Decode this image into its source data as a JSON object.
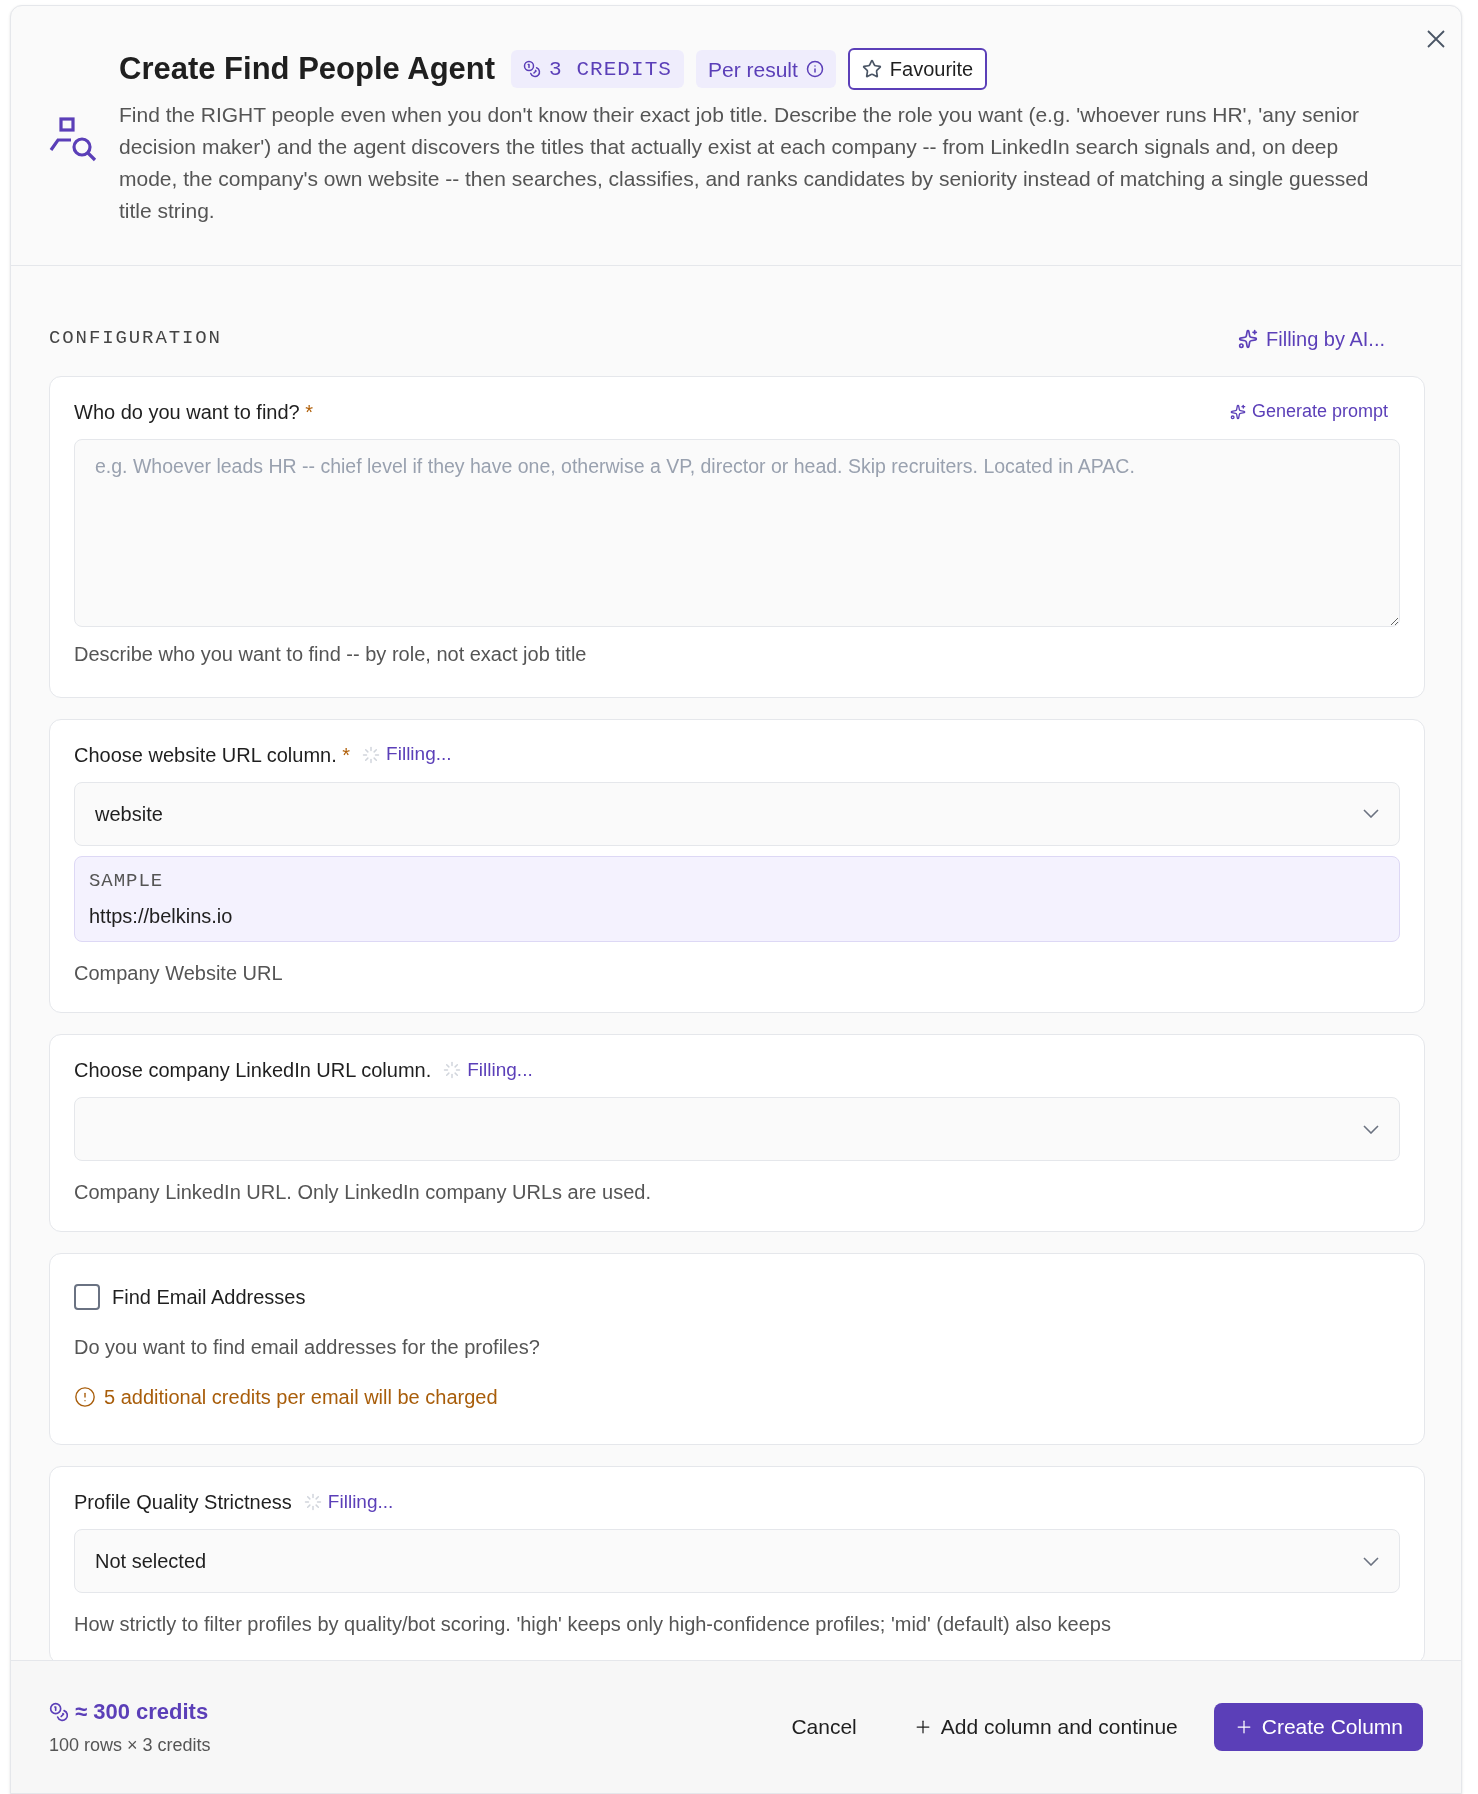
{
  "dialog": {
    "title": "Create Find People Agent",
    "credits_badge": "3 CREDITS",
    "per_result": "Per result",
    "favourite": {
      "label": "Favourite",
      "selected": false
    },
    "description": "Find the RIGHT people even when you don't know their exact job title. Describe the role you want (e.g. 'whoever runs HR', 'any senior decision maker') and the agent discovers the titles that actually exist at each company -- from LinkedIn search signals and, on deep mode, the company's own website -- then searches, classifies, and ranks candidates by seniority instead of matching a single guessed title string."
  },
  "configuration": {
    "heading": "CONFIGURATION",
    "ai_status": "Filling by AI...",
    "fields": [
      {
        "kind": "textarea",
        "label": "Who do you want to find?",
        "required_mark": "*",
        "action": "Generate prompt",
        "placeholder": "e.g. Whoever leads HR -- chief level if they have one, otherwise a VP, director or head. Skip recruiters. Located in APAC.",
        "help": "Describe who you want to find -- by role, not exact job title"
      },
      {
        "kind": "select",
        "label": "Choose website URL column.",
        "required_mark": "*",
        "status": "Filling...",
        "value": "website",
        "sample_label": "SAMPLE",
        "sample_value": "https://belkins.io",
        "help": "Company Website URL"
      },
      {
        "kind": "select",
        "label": "Choose company LinkedIn URL column.",
        "status": "Filling...",
        "help": "Company LinkedIn URL. Only LinkedIn company URLs are used."
      },
      {
        "kind": "checkbox",
        "label": "Find Email Addresses",
        "checked": false,
        "help": "Do you want to find email addresses for the profiles?",
        "warning": "5 additional credits per email will be charged"
      },
      {
        "kind": "select",
        "label": "Profile Quality Strictness",
        "status": "Filling...",
        "value": "Not selected",
        "help": "How strictly to filter profiles by quality/bot scoring. 'high' keeps only high-confidence profiles; 'mid' (default) also keeps"
      }
    ]
  },
  "footer": {
    "estimate": "≈ 300 credits",
    "breakdown": "100 rows × 3 credits",
    "buttons": [
      {
        "kind": "ghost",
        "label": "Cancel"
      },
      {
        "kind": "plus",
        "label": "Add column and continue"
      },
      {
        "kind": "primary",
        "label": "Create Column"
      }
    ]
  }
}
